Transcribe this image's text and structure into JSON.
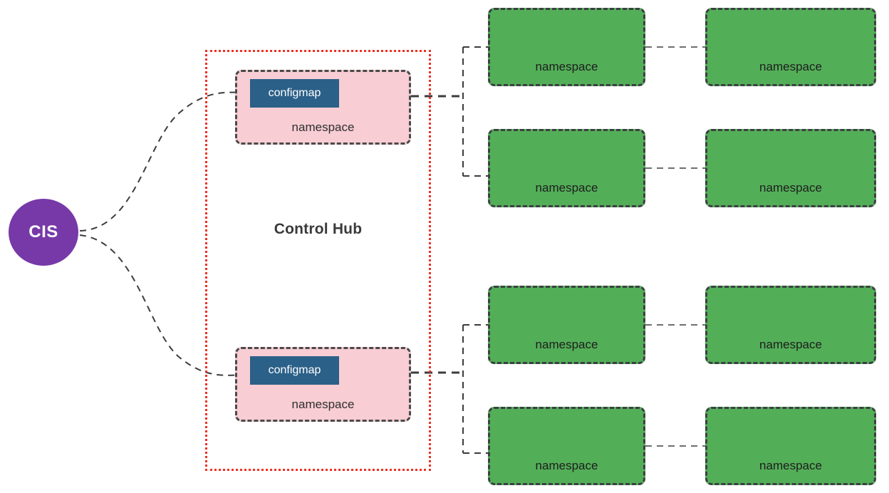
{
  "diagram": {
    "title": "Control Hub",
    "colors": {
      "cis_purple": "#7739A7",
      "configmap_blue": "#2B6088",
      "namespace_pink": "#F8CDD4",
      "namespace_green": "#53AE58",
      "boundary_red": "#EE3124",
      "dashed_border": "#3C4043"
    },
    "cis": {
      "label": "CIS"
    },
    "control_hub": {
      "label": "Control Hub",
      "namespaces": [
        {
          "label": "namespace",
          "configmap": "configmap"
        },
        {
          "label": "namespace",
          "configmap": "configmap"
        }
      ]
    },
    "managed_namespaces": [
      {
        "label": "namespace"
      },
      {
        "label": "namespace"
      },
      {
        "label": "namespace"
      },
      {
        "label": "namespace"
      },
      {
        "label": "namespace"
      },
      {
        "label": "namespace"
      },
      {
        "label": "namespace"
      },
      {
        "label": "namespace"
      }
    ]
  }
}
